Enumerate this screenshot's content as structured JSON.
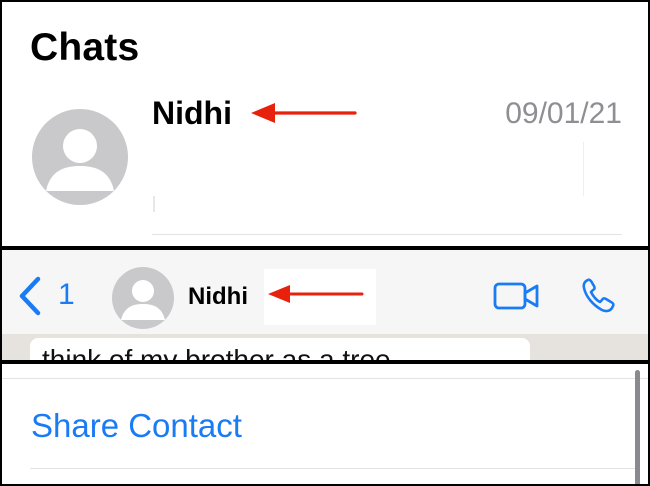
{
  "chats_panel": {
    "title": "Chats",
    "chat_row": {
      "contact_name": "Nidhi",
      "date": "09/01/21",
      "avatar_icon": "person-placeholder-icon",
      "annotation": "red-arrow-icon"
    }
  },
  "conversation_header": {
    "back_count": "1",
    "contact_name": "Nidhi",
    "avatar_icon": "person-placeholder-icon",
    "annotation": "red-arrow-icon",
    "video_call_icon": "video-camera-icon",
    "voice_call_icon": "phone-icon",
    "message_preview": "think of my brother as a tree"
  },
  "contact_info": {
    "share_contact_label": "Share Contact"
  },
  "colors": {
    "accent_blue": "#1a7cf4",
    "annotation_red": "#e8210d",
    "avatar_gray": "#c9c9cb",
    "secondary_text": "#8e8e93"
  }
}
